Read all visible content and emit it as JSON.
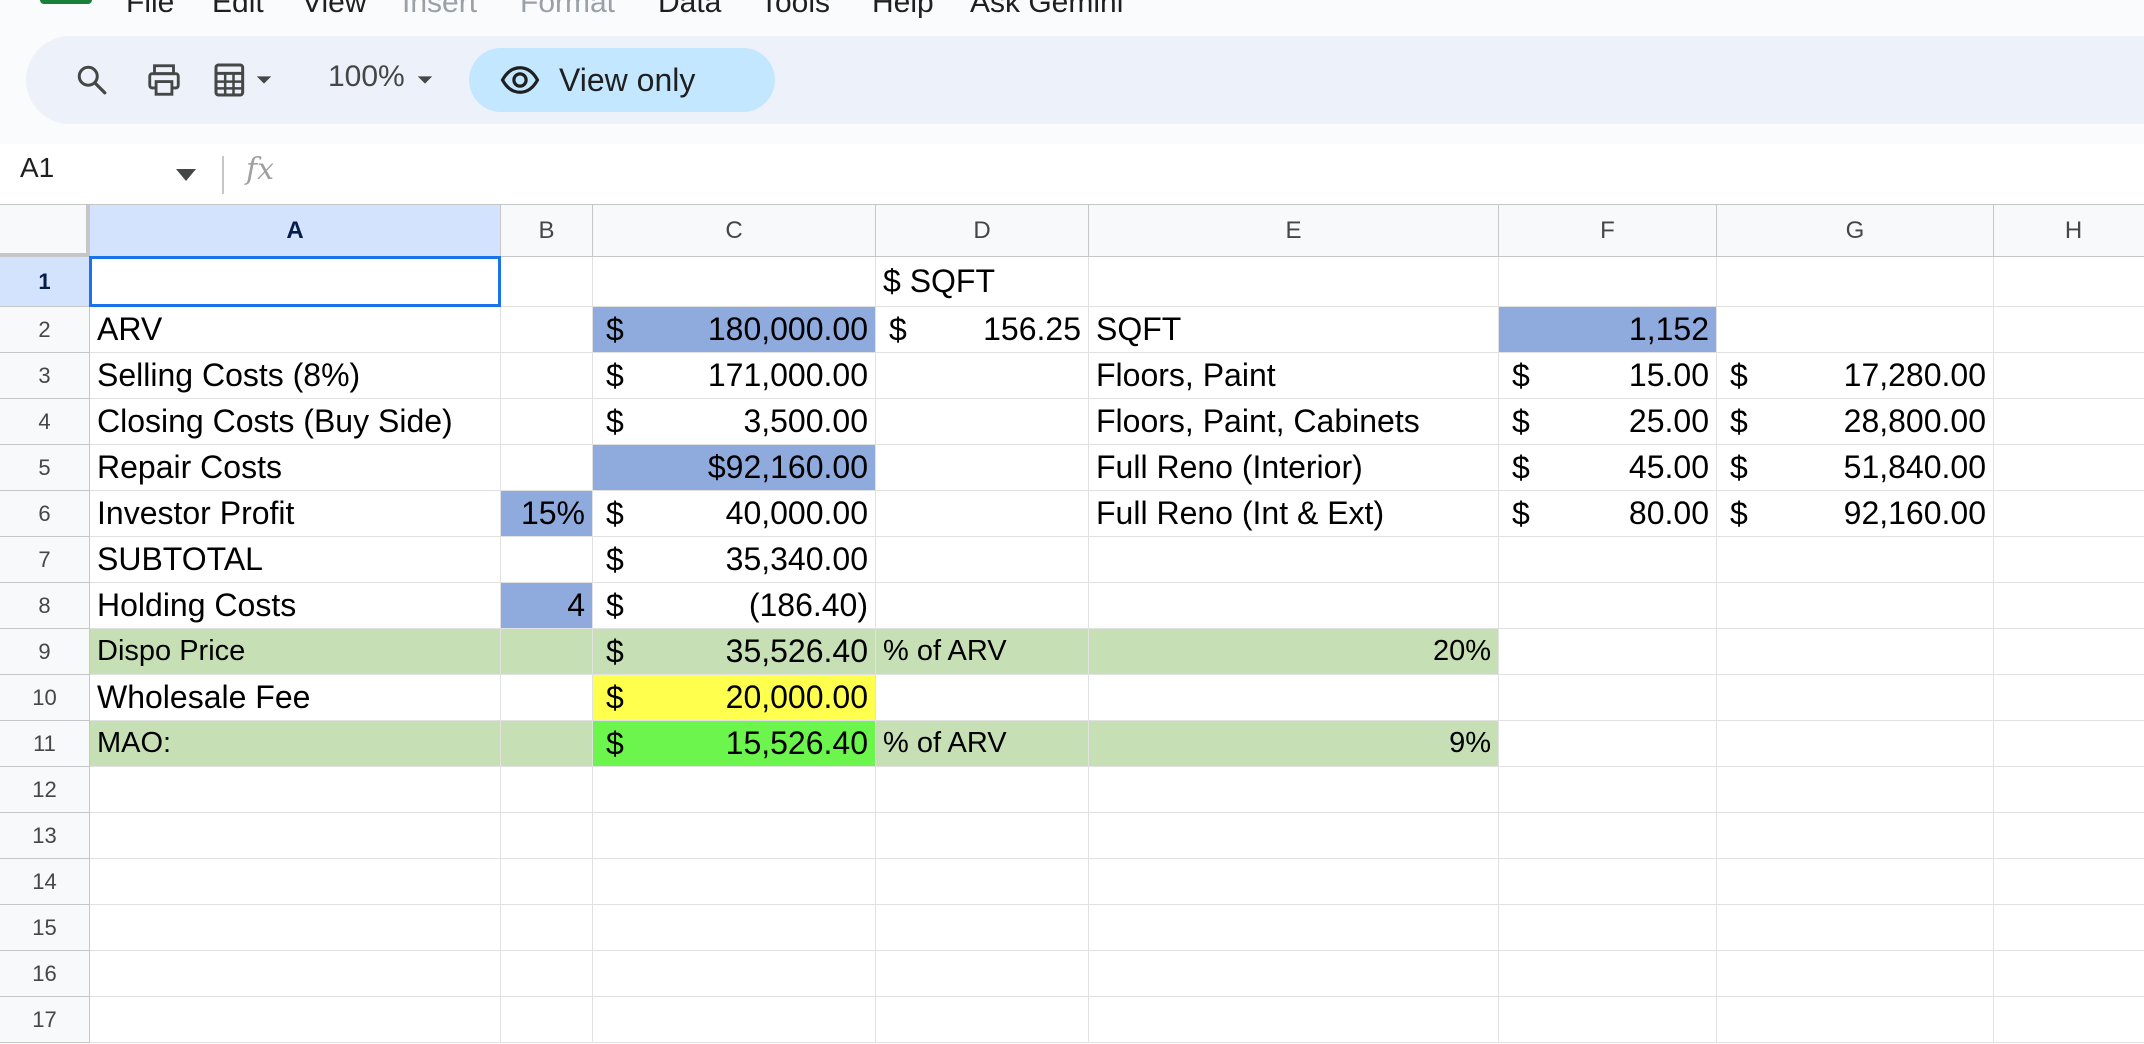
{
  "menu": {
    "items": [
      "File",
      "Edit",
      "View",
      "Insert",
      "Format",
      "Data",
      "Tools",
      "Help",
      "Ask Gemini"
    ],
    "disabled": [
      "Insert",
      "Format"
    ]
  },
  "toolbar": {
    "zoom": "100%",
    "view_only_label": "View only",
    "icons": [
      "search-icon",
      "print-icon",
      "calculator-icon",
      "chevron-down-icon",
      "eye-icon"
    ]
  },
  "formula_bar": {
    "name_box": "A1",
    "fx_label": "fx",
    "value": ""
  },
  "colors": {
    "selection": "#1a73e8",
    "header_active": "#d3e3fd",
    "input_blue": "#8faadc",
    "result_green": "#c6dfb4",
    "highlight_yellow": "#ffff4d",
    "highlight_green": "#6cf54c"
  },
  "sheet": {
    "columns": [
      "A",
      "B",
      "C",
      "D",
      "E",
      "F",
      "G",
      "H"
    ],
    "rows": [
      "1",
      "2",
      "3",
      "4",
      "5",
      "6",
      "7",
      "8",
      "9",
      "10",
      "11",
      "12",
      "13",
      "14",
      "15",
      "16",
      "17"
    ],
    "selected_cell": "A1",
    "cells": [
      {
        "ref": "D1",
        "text": "$ SQFT"
      },
      {
        "ref": "A2",
        "text": "ARV"
      },
      {
        "ref": "C2",
        "cur": "$",
        "text": "180,000.00",
        "fill": "#8faadc"
      },
      {
        "ref": "D2",
        "cur": "$",
        "text": "156.25"
      },
      {
        "ref": "E2",
        "text": "SQFT"
      },
      {
        "ref": "F2",
        "text": "1,152",
        "align": "right",
        "fill": "#8faadc"
      },
      {
        "ref": "A3",
        "text": "Selling Costs (8%)"
      },
      {
        "ref": "C3",
        "cur": "$",
        "text": "171,000.00"
      },
      {
        "ref": "E3",
        "text": "Floors, Paint"
      },
      {
        "ref": "F3",
        "cur": "$",
        "text": "15.00"
      },
      {
        "ref": "G3",
        "cur": "$",
        "text": "17,280.00"
      },
      {
        "ref": "A4",
        "text": "Closing Costs (Buy Side)"
      },
      {
        "ref": "C4",
        "cur": "$",
        "text": "3,500.00"
      },
      {
        "ref": "E4",
        "text": "Floors, Paint, Cabinets"
      },
      {
        "ref": "F4",
        "cur": "$",
        "text": "25.00"
      },
      {
        "ref": "G4",
        "cur": "$",
        "text": "28,800.00"
      },
      {
        "ref": "A5",
        "text": "Repair Costs"
      },
      {
        "ref": "C5",
        "text": "$92,160.00",
        "align": "right",
        "fill": "#8faadc"
      },
      {
        "ref": "E5",
        "text": "Full Reno (Interior)"
      },
      {
        "ref": "F5",
        "cur": "$",
        "text": "45.00"
      },
      {
        "ref": "G5",
        "cur": "$",
        "text": "51,840.00"
      },
      {
        "ref": "A6",
        "text": "Investor Profit"
      },
      {
        "ref": "B6",
        "text": "15%",
        "align": "right",
        "fill": "#8faadc"
      },
      {
        "ref": "C6",
        "cur": "$",
        "text": "40,000.00"
      },
      {
        "ref": "E6",
        "text": "Full Reno (Int & Ext)"
      },
      {
        "ref": "F6",
        "cur": "$",
        "text": "80.00"
      },
      {
        "ref": "G6",
        "cur": "$",
        "text": "92,160.00"
      },
      {
        "ref": "A7",
        "text": "SUBTOTAL"
      },
      {
        "ref": "C7",
        "cur": "$",
        "text": "35,340.00"
      },
      {
        "ref": "A8",
        "text": "Holding Costs"
      },
      {
        "ref": "B8",
        "text": "4",
        "align": "right",
        "fill": "#8faadc"
      },
      {
        "ref": "C8",
        "cur": "$",
        "text": "(186.40)"
      },
      {
        "ref": "A9",
        "text": "Dispo Price",
        "fill": "#c6dfb4",
        "small": true
      },
      {
        "ref": "B9",
        "text": "",
        "fill": "#c6dfb4"
      },
      {
        "ref": "C9",
        "cur": "$",
        "text": "35,526.40",
        "fill": "#c6dfb4"
      },
      {
        "ref": "D9",
        "text": "% of ARV",
        "fill": "#c6dfb4",
        "small": true
      },
      {
        "ref": "E9",
        "text": "20%",
        "align": "right",
        "fill": "#c6dfb4",
        "small": true
      },
      {
        "ref": "A10",
        "text": "Wholesale Fee"
      },
      {
        "ref": "C10",
        "cur": "$",
        "text": "20,000.00",
        "fill": "#ffff4d"
      },
      {
        "ref": "A11",
        "text": "MAO:",
        "fill": "#c6dfb4",
        "small": true
      },
      {
        "ref": "B11",
        "text": "",
        "fill": "#c6dfb4"
      },
      {
        "ref": "C11",
        "cur": "$",
        "text": "15,526.40",
        "fill": "#6cf54c"
      },
      {
        "ref": "D11",
        "text": "% of ARV",
        "fill": "#c6dfb4",
        "small": true
      },
      {
        "ref": "E11",
        "text": "9%",
        "align": "right",
        "fill": "#c6dfb4",
        "small": true
      }
    ]
  }
}
